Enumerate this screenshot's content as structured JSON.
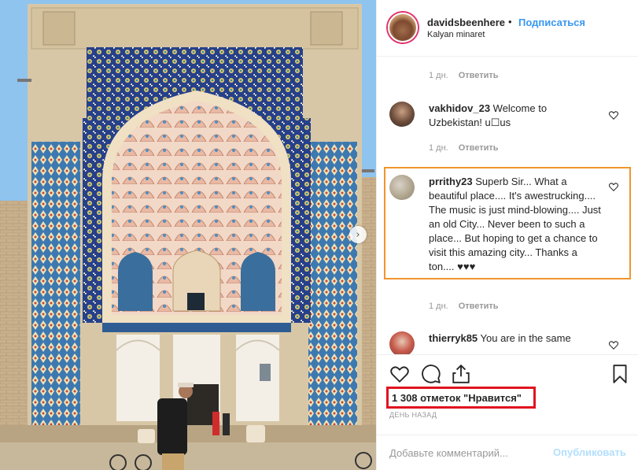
{
  "post": {
    "username": "davidsbeenhere",
    "separator": "•",
    "follow_label": "Подписаться",
    "location": "Kalyan minaret"
  },
  "comments": [
    {
      "username": "",
      "text": "",
      "age": "1 дн.",
      "reply_label": "Ответить"
    },
    {
      "username": "vakhidov_23",
      "text": " Welcome to Uzbekistan! u☐us",
      "age": "1 дн.",
      "reply_label": "Ответить"
    },
    {
      "username": "prrithy23",
      "text": " Superb Sir... What a beautiful place.... It's awestrucking.... The music is just mind-blowing.... Just an old City... Never been to such a place... But hoping to get a chance to visit this amazing city... Thanks a ton.... ♥♥♥",
      "age": "1 дн.",
      "reply_label": "Ответить"
    },
    {
      "username": "thierryk85",
      "text": " You are in the same",
      "age": "",
      "reply_label": ""
    }
  ],
  "actions": {
    "like_icon": "heart-icon",
    "comment_icon": "comment-icon",
    "share_icon": "share-icon",
    "save_icon": "bookmark-icon"
  },
  "likes_text": "1 308 отметок \"Нравится\"",
  "date_text": "ДЕНЬ НАЗАД",
  "add_comment": {
    "placeholder": "Добавьте комментарий...",
    "publish_label": "Опубликовать"
  },
  "colors": {
    "link": "#3897f0",
    "highlight_orange": "#f0952c",
    "highlight_red": "#e0141f"
  }
}
